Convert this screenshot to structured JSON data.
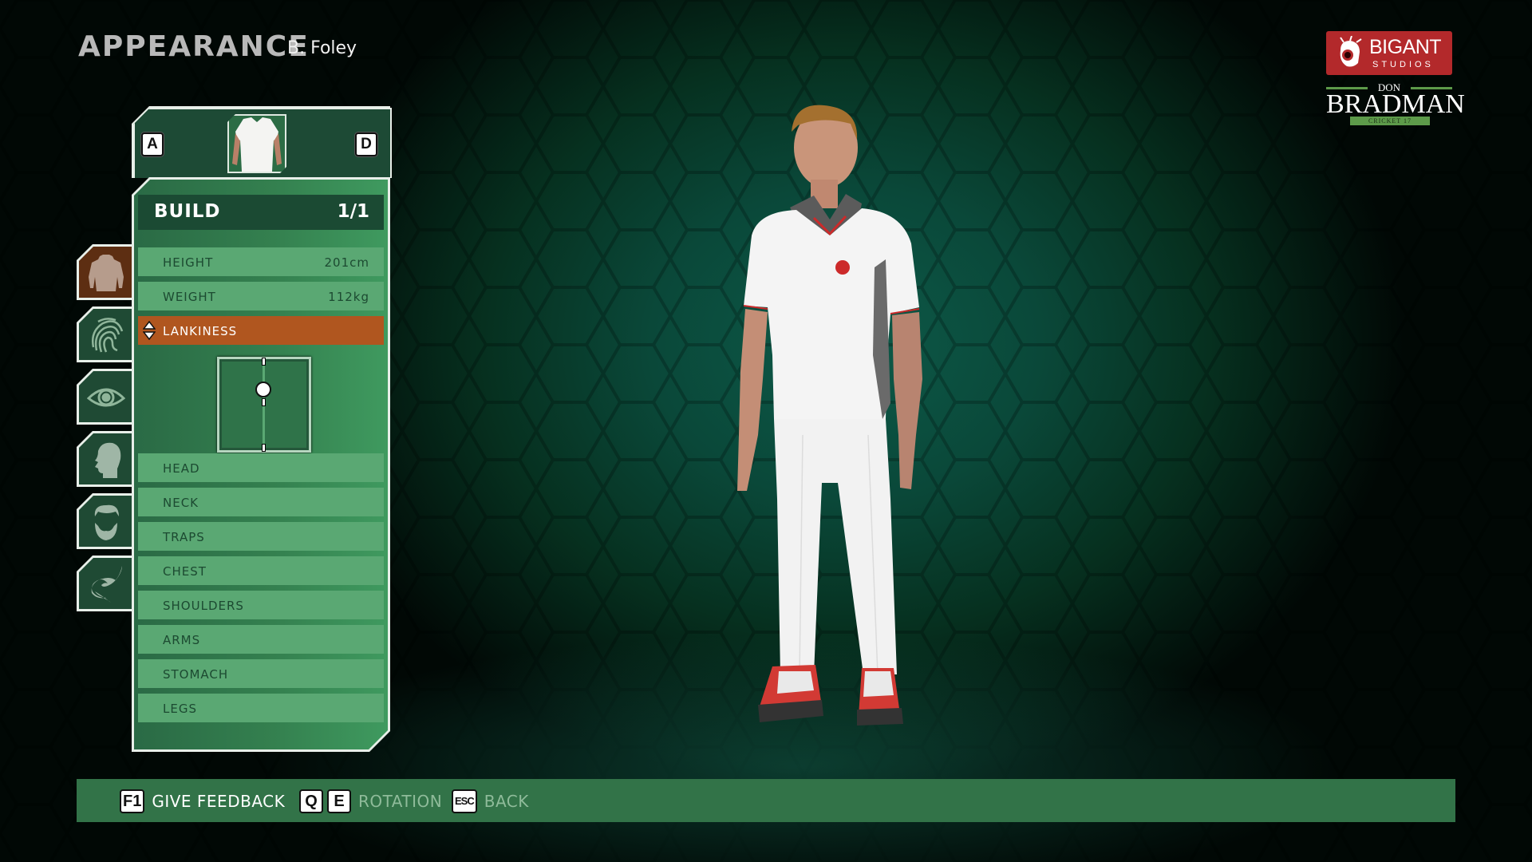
{
  "header": {
    "title": "APPEARANCE",
    "player_name": "B. Foley"
  },
  "branding": {
    "studio_name": "BIGANT",
    "studio_sub": "STUDIOS",
    "game_pre": "DON",
    "game_name": "BRADMAN",
    "game_sub": "CRICKET 17",
    "colors": {
      "studio_red": "#b3292b",
      "game_green": "#5d9a4a"
    }
  },
  "category_nav": {
    "prev_key": "A",
    "next_key": "D",
    "current_thumbnail": "shirt-thumbnail"
  },
  "sidebar": {
    "tabs": [
      {
        "name": "body",
        "icon": "torso-icon",
        "active": true
      },
      {
        "name": "skin",
        "icon": "fingerprint-icon",
        "active": false
      },
      {
        "name": "eyes",
        "icon": "eye-icon",
        "active": false
      },
      {
        "name": "head",
        "icon": "head-profile-icon",
        "active": false
      },
      {
        "name": "hair",
        "icon": "hair-beard-icon",
        "active": false
      },
      {
        "name": "tattoos",
        "icon": "tribal-swirl-icon",
        "active": false
      }
    ]
  },
  "section": {
    "label": "BUILD",
    "page": "1/1"
  },
  "rows_top": [
    {
      "label": "HEIGHT",
      "value": "201cm"
    },
    {
      "label": "WEIGHT",
      "value": "112kg"
    },
    {
      "label": "LANKINESS",
      "value": "",
      "selected": true
    }
  ],
  "lankiness_slider": {
    "value_from_bottom": 0.65,
    "center_marker": 0.5
  },
  "rows_bottom": [
    {
      "label": "HEAD"
    },
    {
      "label": "NECK"
    },
    {
      "label": "TRAPS"
    },
    {
      "label": "CHEST"
    },
    {
      "label": "SHOULDERS"
    },
    {
      "label": "ARMS"
    },
    {
      "label": "STOMACH"
    },
    {
      "label": "LEGS"
    }
  ],
  "bottom_bar": {
    "hints": [
      {
        "keys": [
          "F1"
        ],
        "label": "GIVE FEEDBACK",
        "enabled": true
      },
      {
        "keys": [
          "Q",
          "E"
        ],
        "label": "ROTATION",
        "enabled": false
      },
      {
        "keys": [
          "ESC"
        ],
        "label": "BACK",
        "enabled": false
      }
    ]
  },
  "colors": {
    "selected_row": "#b0561f",
    "row": "#5aa873",
    "section_header": "#1b4a33",
    "bottom_bar": "#327348"
  }
}
